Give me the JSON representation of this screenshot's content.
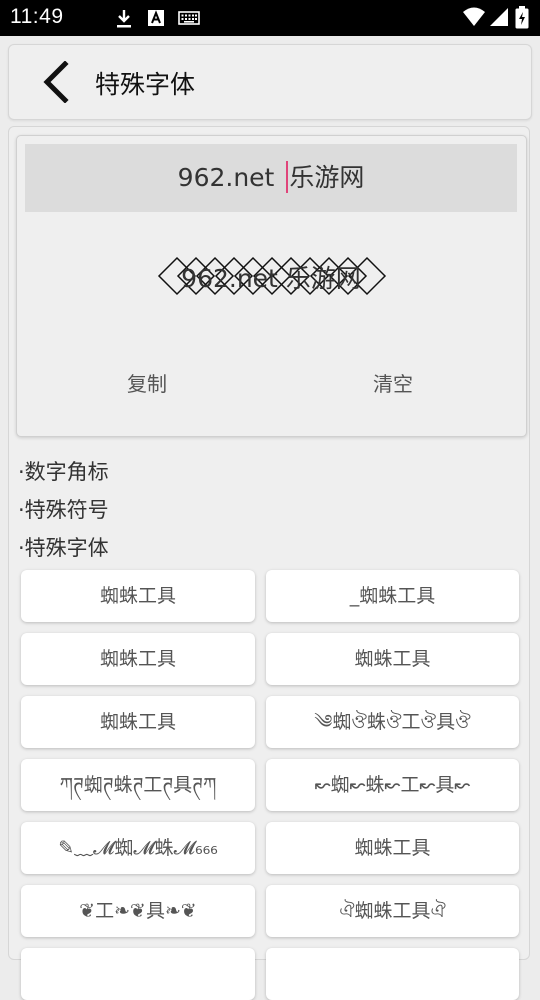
{
  "status_bar": {
    "time": "11:49"
  },
  "header": {
    "title": "特殊字体"
  },
  "editor": {
    "input_value": "962.net 乐游网",
    "input_before_caret": "962.net ",
    "input_after_caret": "乐游网",
    "preview_chars": [
      "9",
      "6",
      "2",
      ".",
      "n",
      "e",
      "t",
      " ",
      "乐",
      "游",
      "网"
    ],
    "copy_label": "复制",
    "clear_label": "清空"
  },
  "sections": [
    "·数字角标",
    "·特殊符号",
    "·特殊字体"
  ],
  "style_buttons": [
    {
      "text": "蜘蛛工具"
    },
    {
      "text": "_蜘蛛工具"
    },
    {
      "text": "蜘蛛工具"
    },
    {
      "text": "蜘蛛工具"
    },
    {
      "text": "蜘蛛工具"
    },
    {
      "text": "༄蜘ঔ蛛ঔ工ঔ具ঔ"
    },
    {
      "text": "ཀཊ蜘ཊ蛛ཊ工ཊ具ཊཀ"
    },
    {
      "text": "↜蜘↜蛛↜工↜具↜"
    },
    {
      "text": "✎﹏𝓜蜘𝓜蛛𝓜₆₆₆"
    },
    {
      "text": "蜘蛛工具"
    },
    {
      "text": "❦工❧❦具❧❦"
    },
    {
      "text": "ঐ蜘蛛工具ঐ"
    },
    {
      "text": ""
    },
    {
      "text": ""
    }
  ]
}
